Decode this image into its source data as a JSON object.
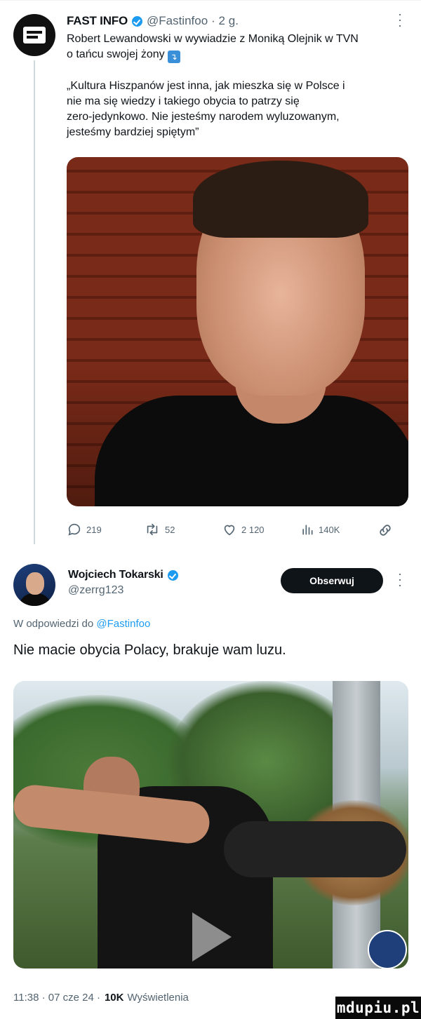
{
  "tweet1": {
    "display_name": "FAST INFO",
    "handle": "@Fastinfoo",
    "time": "· 2 g.",
    "text_line1": "Robert Lewandowski w wywiadzie z Moniką Olejnik w TVN",
    "text_line2": "o tańcu swojej żony",
    "emoji": "⤵️",
    "quote_lines": [
      "„Kultura Hiszpanów jest inna, jak mieszka się w Polsce i",
      "nie ma się wiedzy i takiego obycia to patrzy się",
      "zero-jedynkowo. Nie jesteśmy narodem wyluzowanym,",
      "jesteśmy bardziej spiętym”"
    ],
    "stats": {
      "replies": "219",
      "retweets": "52",
      "likes": "2 120",
      "views": "140K"
    }
  },
  "tweet2": {
    "display_name": "Wojciech Tokarski",
    "handle": "@zerrg123",
    "follow_label": "Obserwuj",
    "reply_prefix": "W odpowiedzi do",
    "reply_handle": "@Fastinfoo",
    "text": "Nie macie obycia Polacy, brakuje wam luzu.",
    "timestamp": "11:38 · 07 cze 24 ·",
    "views_count": "10K",
    "views_label": "Wyświetlenia"
  },
  "watermark": "mdupiu.pl",
  "icons": {
    "verified": "verified-badge-icon",
    "more": "more-dots-icon",
    "reply": "reply-icon",
    "retweet": "retweet-icon",
    "like": "heart-icon",
    "views": "views-bars-icon",
    "share": "share-icon",
    "play": "play-icon"
  },
  "colors": {
    "accent": "#1d9bf0",
    "text": "#0f1419",
    "secondary": "#536471",
    "button": "#0f1419"
  }
}
